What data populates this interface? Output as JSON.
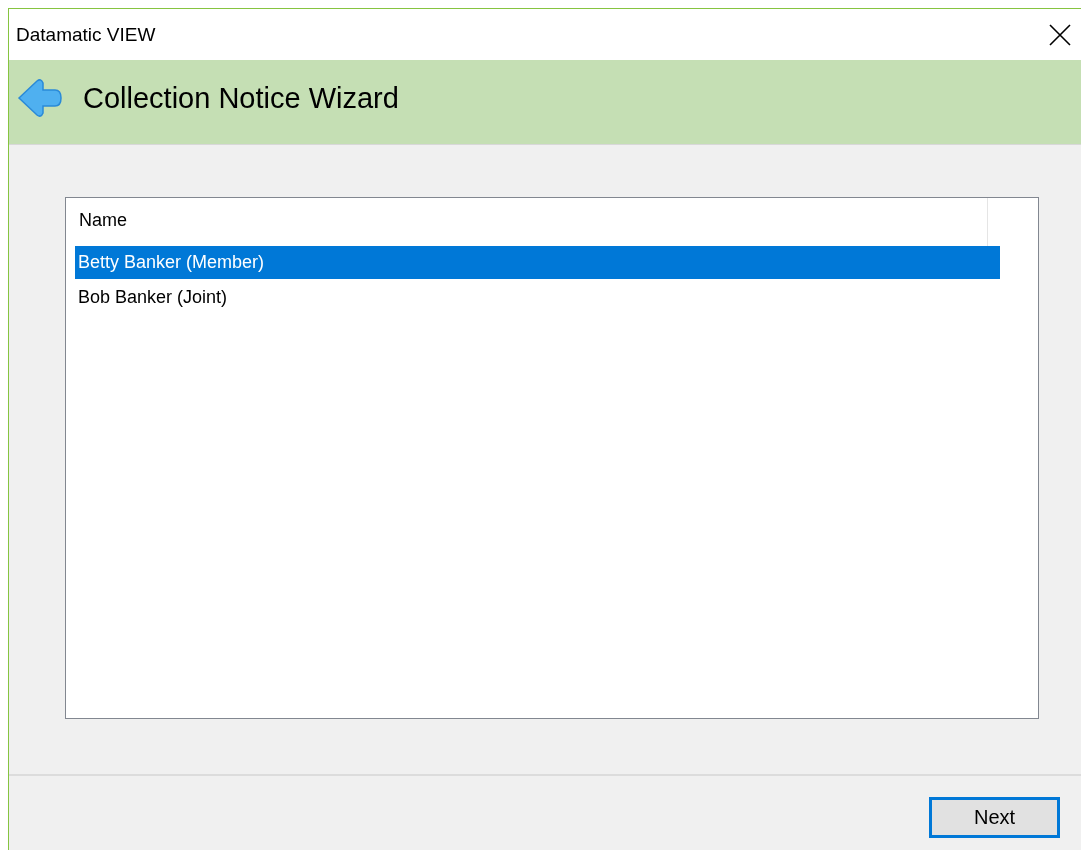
{
  "window": {
    "title": "Datamatic VIEW"
  },
  "header": {
    "title": "Collection Notice Wizard"
  },
  "list": {
    "columns": [
      "Name"
    ],
    "rows": [
      {
        "name": "Betty Banker (Member)",
        "selected": true
      },
      {
        "name": "Bob Banker (Joint)",
        "selected": false
      }
    ]
  },
  "buttons": [
    {
      "label": "Next",
      "focused": true
    }
  ]
}
